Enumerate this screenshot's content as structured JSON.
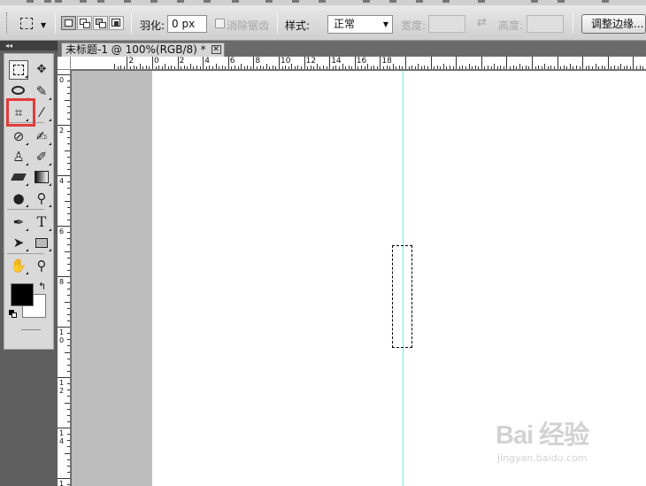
{
  "options_bar": {
    "feather_label": "羽化:",
    "feather_value": "0 px",
    "antialias_label": "消除锯齿",
    "style_label": "样式:",
    "style_value": "正常",
    "width_label": "宽度:",
    "height_label": "高度:",
    "refine_edge_label": "调整边缘..."
  },
  "toolbox": {
    "collapse_glyph": "◂◂",
    "selected_tool": "rectangular-marquee-tool",
    "foreground_color": "#000000",
    "background_color": "#ffffff"
  },
  "document": {
    "tab_title": "未标题-1 @ 100%(RGB/8) *",
    "close_glyph": "✕"
  },
  "rulers": {
    "horizontal_labels": [
      "2",
      "0",
      "2",
      "4",
      "6",
      "8",
      "10",
      "12",
      "14",
      "16",
      "18"
    ],
    "vertical_labels": [
      "0",
      "2",
      "4",
      "6",
      "8",
      "1\n0",
      "1\n2",
      "1\n4",
      "1"
    ]
  },
  "watermark": {
    "brand": "Bai 经验",
    "url": "jingyan.baidu.com"
  },
  "colors": {
    "guide": "#5ef3f3",
    "highlight": "#e23a3a",
    "pasteboard": "#bdbdbd"
  }
}
